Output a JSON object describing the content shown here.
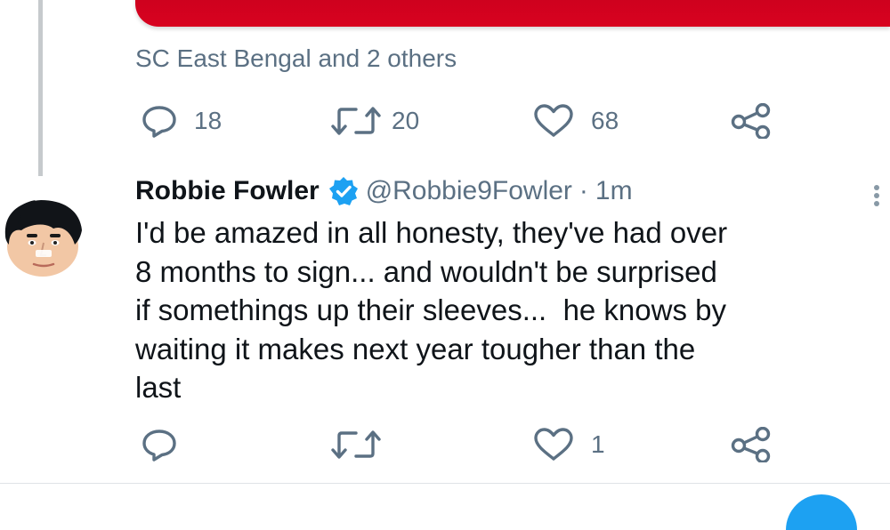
{
  "previous_tweet": {
    "reply_context": "SC East Bengal and 2 others",
    "actions": {
      "replies": "18",
      "retweets": "20",
      "likes": "68"
    }
  },
  "tweet": {
    "author_name": "Robbie Fowler",
    "handle": "@Robbie9Fowler",
    "separator": "·",
    "time": "1m",
    "text_lines": [
      "I'd be amazed in all honesty, they've had over",
      "8 months to sign... and wouldn't be surprised",
      "if somethings up their sleeves...  he knows by",
      "waiting it makes next year tougher than the",
      "last"
    ],
    "actions": {
      "likes": "1"
    }
  },
  "colors": {
    "accent": "#1da1f2",
    "muted": "#5b7083",
    "text": "#0f1419",
    "banner_red": "#d0001f"
  },
  "icons": [
    "reply-icon",
    "retweet-icon",
    "like-icon",
    "share-icon",
    "verified-badge-icon",
    "more-options-icon"
  ]
}
